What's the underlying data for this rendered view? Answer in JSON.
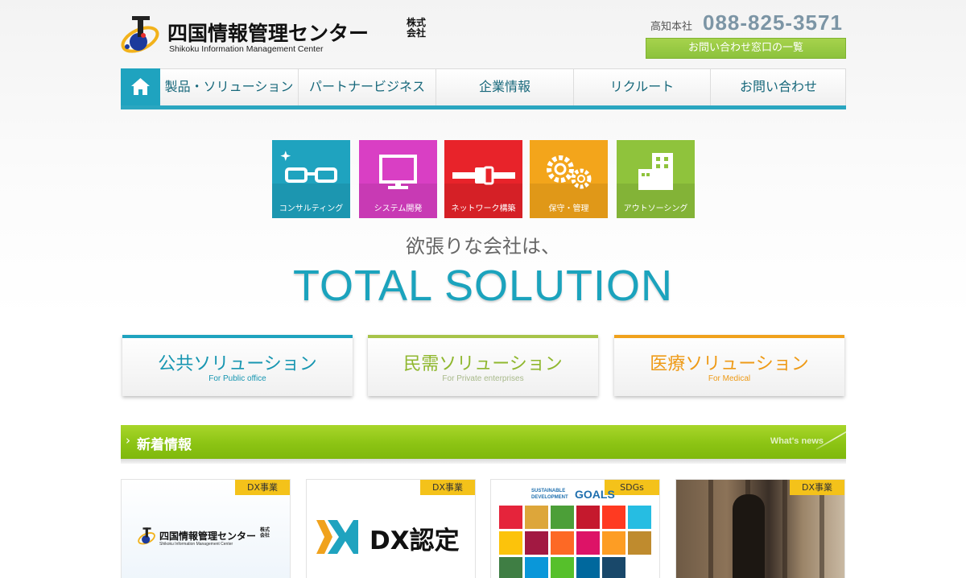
{
  "header": {
    "company_jp": "四国情報管理センター",
    "company_suffix": "株式会社",
    "company_en": "Shikoku Information Management Center",
    "hq_label": "高知本社",
    "phone": "088-825-3571",
    "contact_button": "お問い合わせ窓口の一覧"
  },
  "nav": {
    "home_icon": "home-icon",
    "items": [
      "製品・ソリューション",
      "パートナービジネス",
      "企業情報",
      "リクルート",
      "お問い合わせ"
    ]
  },
  "services": [
    {
      "label": "コンサルティング",
      "icon": "glasses-icon",
      "color": "#1fa3bf"
    },
    {
      "label": "システム開発",
      "icon": "monitor-icon",
      "color": "#d93fc4"
    },
    {
      "label": "ネットワーク構築",
      "icon": "connector-icon",
      "color": "#e8232a"
    },
    {
      "label": "保守・管理",
      "icon": "gears-icon",
      "color": "#f3a51b"
    },
    {
      "label": "アウトソーシング",
      "icon": "building-icon",
      "color": "#8fc33c"
    }
  ],
  "hero": {
    "tagline": "欲張りな会社は、",
    "headline": "TOTAL SOLUTION"
  },
  "solutions": [
    {
      "title": "公共ソリューション",
      "sub": "For Public office",
      "color": "#1fa3bf"
    },
    {
      "title": "民需ソリューション",
      "sub": "For Private enterprises",
      "color": "#8fb72e"
    },
    {
      "title": "医療ソリューション",
      "sub": "For Medical",
      "color": "#f0a21d"
    }
  ],
  "news": {
    "title": "新着情報",
    "subtitle": "What's news",
    "cards": [
      {
        "badge": "DX事業",
        "logo_jp": "四国情報管理センター",
        "logo_suffix": "株式会社",
        "logo_en": "Shikoku Information Management Center"
      },
      {
        "badge": "DX事業",
        "logo_text": "DX認定"
      },
      {
        "badge": "SDGs",
        "heading_line1": "SUSTAINABLE",
        "heading_line2": "DEVELOPMENT",
        "heading_goals": "GOALS"
      },
      {
        "badge": "DX事業"
      }
    ]
  }
}
